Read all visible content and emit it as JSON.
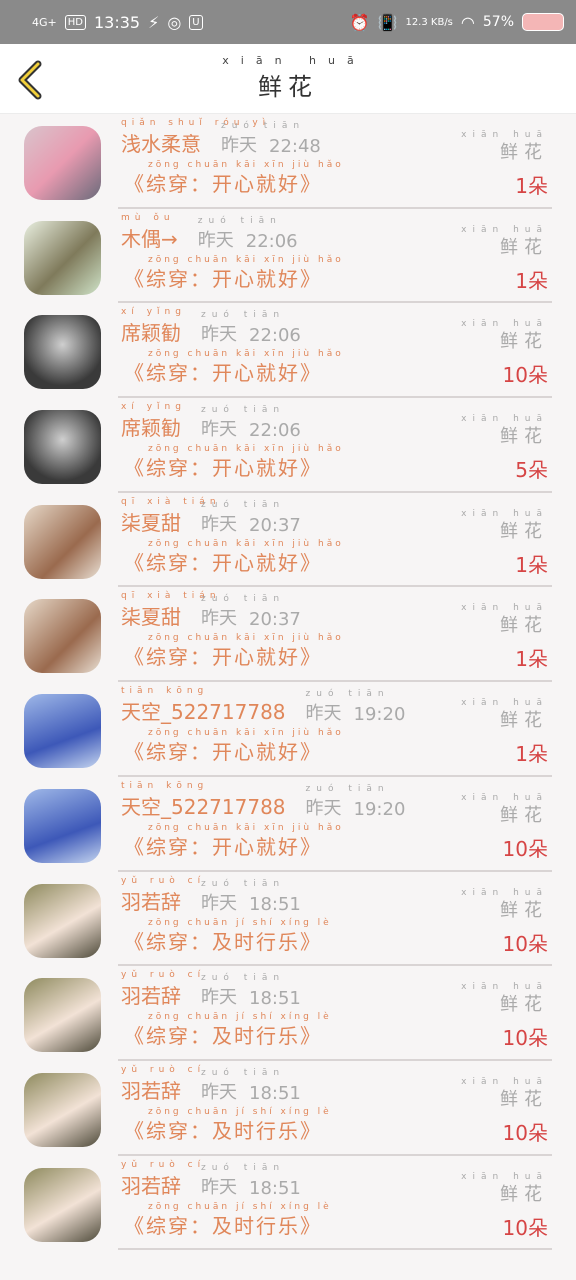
{
  "status": {
    "network": "4G+",
    "hd": "HD",
    "time": "13:35",
    "speed": "12.3 KB/s",
    "battery": "57%"
  },
  "header": {
    "title_pinyin": "xiān huā",
    "title": "鲜花"
  },
  "common": {
    "yesterday": "昨天",
    "yesterday_pinyin": "zuó tiān",
    "flower": "鲜花",
    "flower_pinyin": "xiān huā"
  },
  "items": [
    {
      "name": "浅水柔意",
      "name_pinyin": "qiǎn shuǐ róu yì",
      "time": "22:48",
      "gift": "《综穿：开心就好》",
      "gift_pinyin": "zōng chuān  kāi xīn jiù hǎo",
      "count": "1朵"
    },
    {
      "name": "木偶→",
      "name_pinyin": "mù ǒu",
      "time": "22:06",
      "gift": "《综穿：开心就好》",
      "gift_pinyin": "zōng chuān  kāi xīn jiù hǎo",
      "count": "1朵"
    },
    {
      "name": "席颖勧",
      "name_pinyin": "xí yǐng",
      "time": "22:06",
      "gift": "《综穿：开心就好》",
      "gift_pinyin": "zōng chuān  kāi xīn jiù hǎo",
      "count": "10朵"
    },
    {
      "name": "席颖勧",
      "name_pinyin": "xí yǐng",
      "time": "22:06",
      "gift": "《综穿：开心就好》",
      "gift_pinyin": "zōng chuān  kāi xīn jiù hǎo",
      "count": "5朵"
    },
    {
      "name": "柒夏甜",
      "name_pinyin": "qī xià tián",
      "time": "20:37",
      "gift": "《综穿：开心就好》",
      "gift_pinyin": "zōng chuān  kāi xīn jiù hǎo",
      "count": "1朵"
    },
    {
      "name": "柒夏甜",
      "name_pinyin": "qī xià tián",
      "time": "20:37",
      "gift": "《综穿：开心就好》",
      "gift_pinyin": "zōng chuān  kāi xīn jiù hǎo",
      "count": "1朵"
    },
    {
      "name": "天空_522717788",
      "name_pinyin": "tiān kōng",
      "time": "19:20",
      "gift": "《综穿：开心就好》",
      "gift_pinyin": "zōng chuān  kāi xīn jiù hǎo",
      "count": "1朵"
    },
    {
      "name": "天空_522717788",
      "name_pinyin": "tiān kōng",
      "time": "19:20",
      "gift": "《综穿：开心就好》",
      "gift_pinyin": "zōng chuān  kāi xīn jiù hǎo",
      "count": "10朵"
    },
    {
      "name": "羽若辞",
      "name_pinyin": "yǔ ruò cí",
      "time": "18:51",
      "gift": "《综穿：及时行乐》",
      "gift_pinyin": "zōng chuān  jí shí xíng lè",
      "count": "10朵"
    },
    {
      "name": "羽若辞",
      "name_pinyin": "yǔ ruò cí",
      "time": "18:51",
      "gift": "《综穿：及时行乐》",
      "gift_pinyin": "zōng chuān  jí shí xíng lè",
      "count": "10朵"
    },
    {
      "name": "羽若辞",
      "name_pinyin": "yǔ ruò cí",
      "time": "18:51",
      "gift": "《综穿：及时行乐》",
      "gift_pinyin": "zōng chuān  jí shí xíng lè",
      "count": "10朵"
    },
    {
      "name": "羽若辞",
      "name_pinyin": "yǔ ruò cí",
      "time": "18:51",
      "gift": "《综穿：及时行乐》",
      "gift_pinyin": "zōng chuān  jí shí xíng lè",
      "count": "10朵"
    }
  ]
}
